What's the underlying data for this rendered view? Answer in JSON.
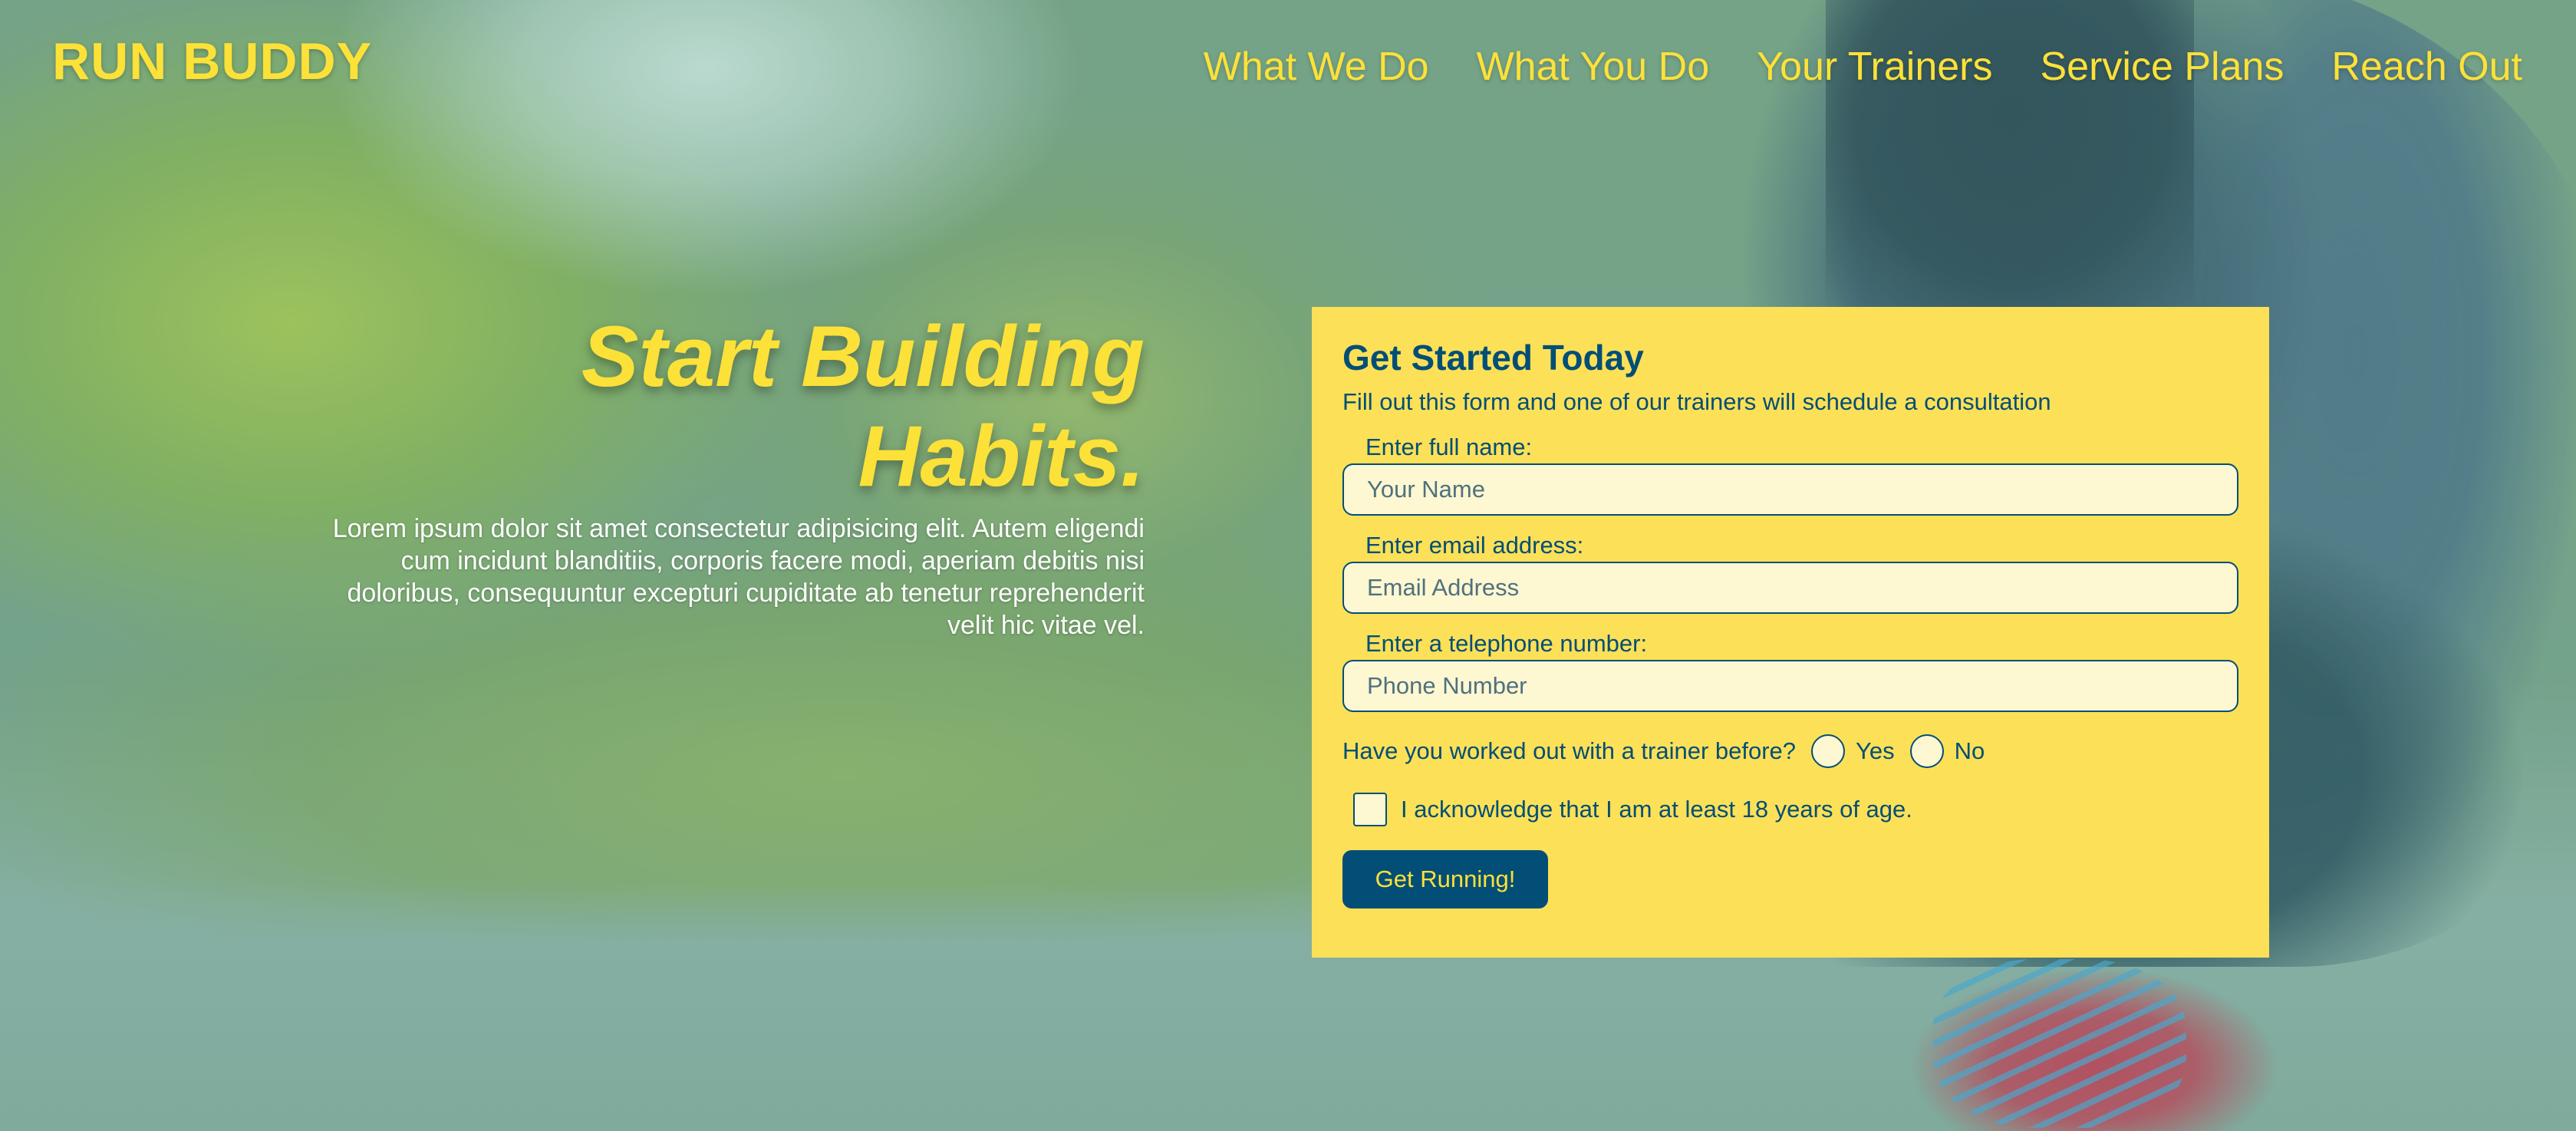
{
  "brand": {
    "logo": "RUN BUDDY"
  },
  "nav": {
    "items": [
      {
        "label": "What We Do"
      },
      {
        "label": "What You Do"
      },
      {
        "label": "Your Trainers"
      },
      {
        "label": "Service Plans"
      },
      {
        "label": "Reach Out"
      }
    ]
  },
  "hero": {
    "title_line1": "Start Building",
    "title_line2": "Habits.",
    "body": "Lorem ipsum dolor sit amet consectetur adipisicing elit. Autem eligendi cum incidunt blanditiis, corporis facere modi, aperiam debitis nisi doloribus, consequuntur excepturi cupiditate ab tenetur reprehenderit velit hic vitae vel."
  },
  "form": {
    "title": "Get Started Today",
    "subtitle": "Fill out this form and one of our trainers will schedule a consultation",
    "name": {
      "label": "Enter full name:",
      "placeholder": "Your Name",
      "value": ""
    },
    "email": {
      "label": "Enter email address:",
      "placeholder": "Email Address",
      "value": ""
    },
    "phone": {
      "label": "Enter a telephone number:",
      "placeholder": "Phone Number",
      "value": ""
    },
    "trainer_question": "Have you worked out with a trainer before?",
    "radio_yes": "Yes",
    "radio_no": "No",
    "acknowledge": "I acknowledge that I am at least 18 years of age.",
    "submit_label": "Get Running!"
  },
  "colors": {
    "accent_yellow": "#fce138",
    "card_bg": "#fce058",
    "primary_blue": "#024e76",
    "input_bg": "#fdf7d2"
  }
}
